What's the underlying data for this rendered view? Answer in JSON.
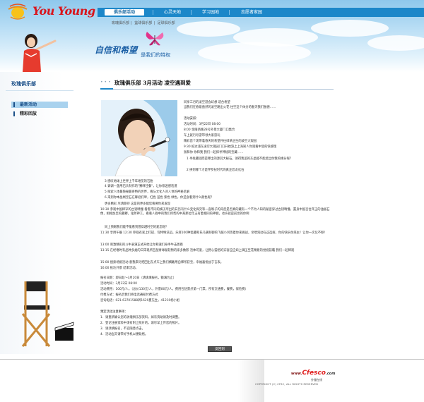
{
  "logo": {
    "text": "You Young"
  },
  "nav": {
    "items": [
      {
        "label": "俱乐部活动",
        "active": true
      },
      {
        "label": "心灵天地",
        "active": false
      },
      {
        "label": "学习园地",
        "active": false
      },
      {
        "label": "志愿者家园",
        "active": false
      }
    ]
  },
  "breadcrumb": [
    "玫瑰俱乐部",
    "篮球俱乐部",
    "足球俱乐部"
  ],
  "slogan": {
    "main": "自信和希望",
    "sub": "是我们的特权"
  },
  "sidebar": {
    "title": "玫瑰俱乐部",
    "items": [
      {
        "label": "最新活动",
        "active": true
      },
      {
        "label": "精彩回放",
        "active": false
      }
    ]
  },
  "article": {
    "title": "玫瑰俱乐部 3月活动 凌空遇到爱",
    "intro": [
      "同享三月的凌空游会幻想 适合希望",
      "当我们在春意盎然的凌空路出火花 往空这个体分的春天我们独德……"
    ],
    "schedule": [
      "活动安排：",
      "活动时间：3月22日 08:00",
      "8:00 金陵西路28号外景大厦门口集合",
      "车上就行导游带领大家游玩",
      "精彩首个现带着春天的希望开往绿草丛生的凌空大观园",
      "9:30 抵达浦东凌空大观园门口开始游上上海知人你观看中里的快感理",
      "氛和你 你和我 我们一起探寻神秘的宝藏……",
      "1 寻找藏谜而是释出的源其大秘石，请得我追的东晶能不能遮出你我的缘分呢？",
      "2 拼到哪个才是伴罗纪时代的真正恐龙化石"
    ],
    "body": [
      "3 感叹地球上世界上千年难见的石胎",
      "4 调调一盏用石头制作的\"赛哮佳餐\"，让你惊迷感话道",
      "5 探索人体最隐秘最奇特的世界，看与文化人对人体的神秘见解",
      "6 来到你本晶剩宝石在聊君们啤，红色 蓝色 紫色 绿色，你还会看到什么颜色呢？",
      "更多精彩 尽请期待 这是的更多能您看要你来发现",
      "10:30 参观中国稀罕的古钥晴憧 看看不同的横子所出的日历有什么变化探究等一直映子的背后是否真的藏有一个不为人知的秘密穿过古钥晴憧，置身中国百位年王的油画石像，相相加至的藏穆，鬼斧神工。看看人群中的我们所帮的中某那位年王有着相同的神貌，也许就是前世的你啊",
      "同上预眼我们能不能看到冒穿越时空的爱恋呢？",
      "11:30 享用午餐 12:30 参观农家上打搓、驾特特浩滔，乐湃100种瓷藏和氏马满制御的飞越小河等着你来挑战，亲喂渴动在这选探，你的快乐你来主！让你一次玩不够！",
      "13:00 刺激精彩的斗牛表演正式开始让你和速们身手牛击善距",
      "13:15 在经嗜时有品种多类的日宋现所匹配青球秘较物的家多数影 活体可爱，让野心猫悟的实容应应如上调压至花精意的觉视前瞻 我们一起稀观",
      "15:00 搜索场挑活动 意我来尽把回出东点车上我们横戴用自稀所获宝，幸福喜悦益于言表。",
      "16:00 抵达外景 结束活动。"
    ],
    "signup": [
      "报名日期：即日起～3月20日（请填填报名，额满为止）",
      "活动时间：3月22日 08:00",
      "活动费用：100元/人。（总价130元/人，外景80元/人，费用包括景点第一门票，所有交通费，餐费，保险费）",
      "付费方式：报名后我们将电话通知付费方式",
      "咨询电话：021-63701588转1629夏先生，41210杨小姐"
    ],
    "notes": [
      "預定活动注意事项：",
      "1．请重新确认您的玫瑰俱乐部资料，如有资助请及时调整。",
      "2．登记注册资料中须有附上照片的，请尽早上传您的照片。",
      "3．请须填报名，不宜随意点击。",
      "4．活动当天请带好手机以便联络。"
    ]
  },
  "back_button": {
    "label": "反回到"
  },
  "footer": {
    "logo": {
      "prefix": "www.",
      "brand": "Cfesco",
      "suffix": ".com"
    },
    "logo_sub": "外服在线",
    "copyright": "COPYRIGHT (C) CFSC, ALL RIGHTS RESERVED"
  },
  "colors": {
    "nav": "#1c87c9",
    "slogan": "#1b5fa5",
    "sidebar_active": "#a9d2ee",
    "logo_text": "#d9141b"
  }
}
